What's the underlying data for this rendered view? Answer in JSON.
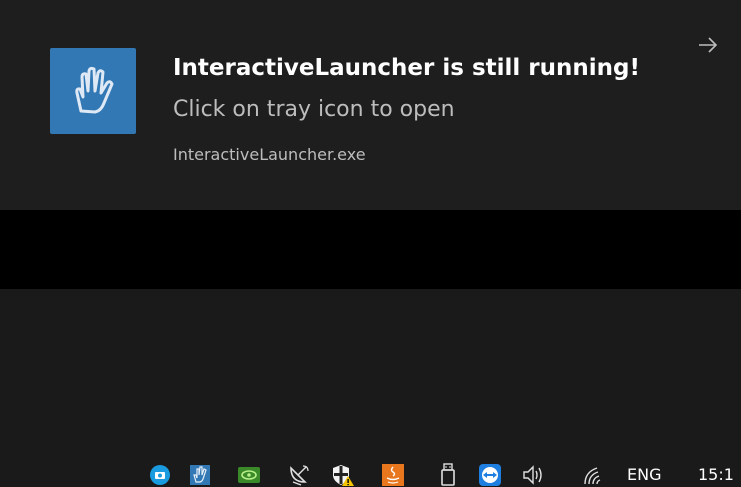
{
  "toast": {
    "title": "InteractiveLauncher is still running!",
    "body": "Click on tray icon to open",
    "source": "InteractiveLauncher.exe",
    "app_icon": "hand-icon",
    "dismiss_icon": "arrow-right-icon"
  },
  "taskbar": {
    "tray_icons": [
      "camera-icon",
      "interactive-launcher-hand-icon",
      "nvidia-icon",
      "satellite-dish-icon",
      "security-shield-warning-icon",
      "java-icon",
      "usb-drive-icon",
      "teamviewer-icon",
      "volume-icon",
      "wifi-icon"
    ],
    "language": "ENG",
    "clock": "15:1"
  },
  "colors": {
    "toast_background": "#1e1e1e",
    "taskbar_background": "#000000",
    "app_icon_background": "#3278b4",
    "title_text": "#ffffff",
    "secondary_text": "#bdbdbd"
  }
}
